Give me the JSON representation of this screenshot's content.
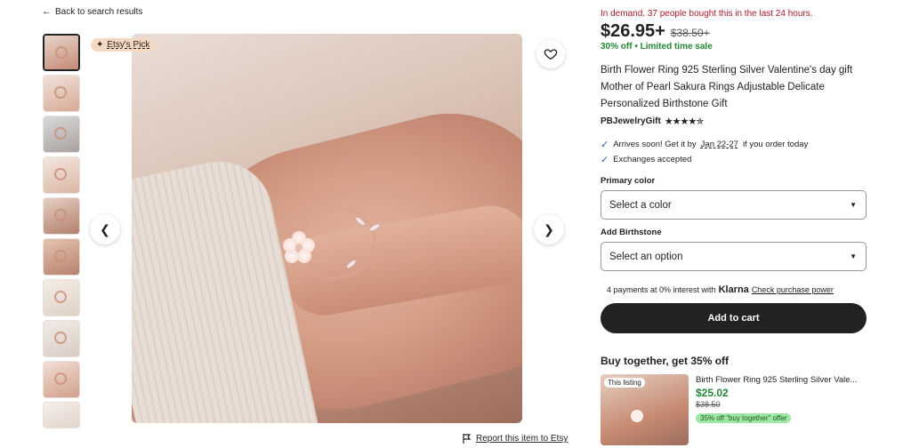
{
  "nav": {
    "back_label": "Back to search results",
    "back_icon": "arrow-left-icon"
  },
  "gallery": {
    "badge_label": "Etsy's Pick",
    "thumbnail_count": 10,
    "report_label": "Report this item to Etsy",
    "prev_icon": "chevron-left-icon",
    "next_icon": "chevron-right-icon",
    "favorite_icon": "heart-icon"
  },
  "product": {
    "demand_text": "In demand. 37 people bought this in the last 24 hours.",
    "price": "$26.95+",
    "old_price": "$38.50+",
    "sale_text": "30% off • Limited time sale",
    "title": "Birth Flower Ring 925 Sterling Silver Valentine's day gift Mother of Pearl Sakura Rings Adjustable Delicate Personalized Birthstone Gift",
    "shop_name": "PBJewelryGift",
    "rating_stars": "★★★★✯",
    "rating": 4.5
  },
  "shipping": {
    "arrival_prefix": "Arrives soon! Get it by",
    "arrival_dates": "Jan 22-27",
    "arrival_suffix": "if you order today",
    "exchanges": "Exchanges accepted"
  },
  "options": {
    "color_label": "Primary color",
    "color_placeholder": "Select a color",
    "birthstone_label": "Add Birthstone",
    "birthstone_placeholder": "Select an option"
  },
  "payment": {
    "klarna_prefix": "4 payments at 0% interest with",
    "klarna_brand": "Klarna",
    "klarna_link": "Check purchase power"
  },
  "cart": {
    "button_label": "Add to cart"
  },
  "bundle": {
    "heading": "Buy together, get 35% off",
    "tag": "This listing",
    "title": "Birth Flower Ring 925 Sterling Silver Vale...",
    "price": "$25.02",
    "old_price": "$38.50",
    "offer": "35% off \"buy together\" offer"
  },
  "colors": {
    "demand_red": "#a61a2e",
    "sale_green": "#258635",
    "button_dark": "#222222",
    "badge_peach": "#f6d8c3"
  }
}
